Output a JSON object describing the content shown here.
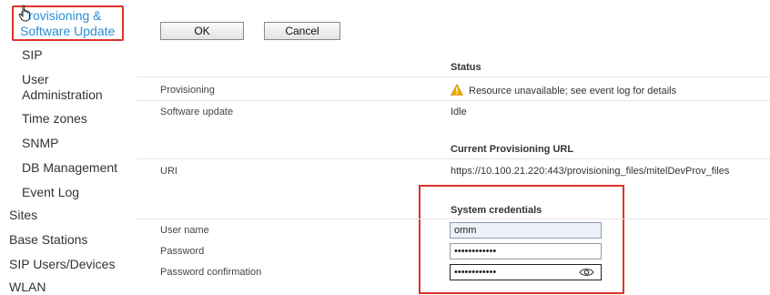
{
  "nav": {
    "active": {
      "line1": "Provisioning &",
      "line2": "Software Update"
    },
    "sip": "SIP",
    "user_admin": {
      "line1": "User",
      "line2": "Administration"
    },
    "time_zones": "Time zones",
    "snmp": "SNMP",
    "db_management": "DB Management",
    "event_log": "Event Log",
    "sites": "Sites",
    "base_stations": "Base Stations",
    "sip_users": "SIP Users/Devices",
    "wlan": "WLAN"
  },
  "buttons": {
    "ok": "OK",
    "cancel": "Cancel"
  },
  "status": {
    "heading": "Status",
    "provisioning_label": "Provisioning",
    "provisioning_value": "Resource unavailable; see event log for details",
    "software_label": "Software update",
    "software_value": "Idle"
  },
  "provisioning_url": {
    "heading": "Current Provisioning URL",
    "uri_label": "URI",
    "uri_value": "https://10.100.21.220:443/provisioning_files/mitelDevProv_files"
  },
  "credentials": {
    "heading": "System credentials",
    "username_label": "User name",
    "username_value": "omm",
    "password_label": "Password",
    "password_value": "••••••••••••",
    "confirm_label": "Password confirmation",
    "confirm_value": "••••••••••••"
  },
  "colors": {
    "accent": "#2a8fd4",
    "highlight": "#d9342b",
    "warning": "#f0a500"
  }
}
